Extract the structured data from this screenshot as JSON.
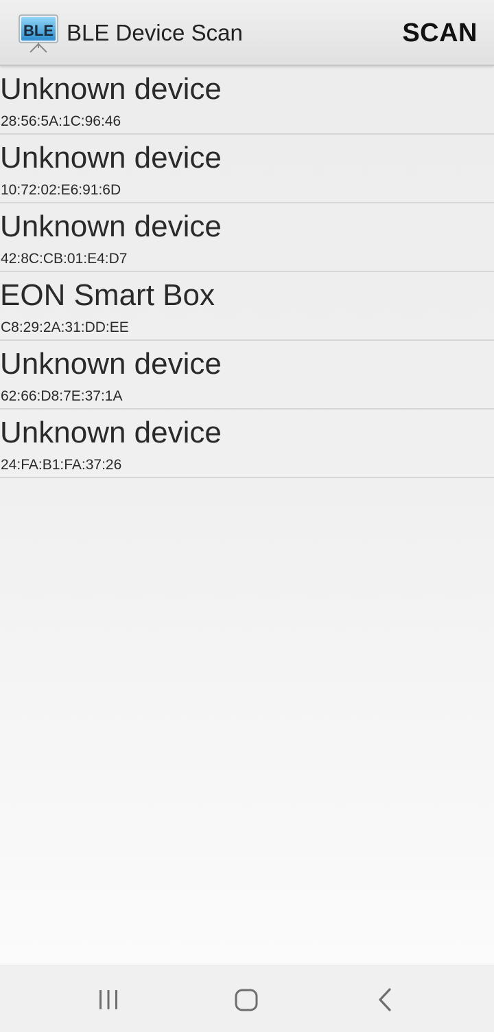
{
  "action_bar": {
    "title": "BLE Device Scan",
    "icon_text": "BLE",
    "scan_label": "SCAN"
  },
  "devices": [
    {
      "name": "Unknown device",
      "address": "28:56:5A:1C:96:46"
    },
    {
      "name": "Unknown device",
      "address": "10:72:02:E6:91:6D"
    },
    {
      "name": "Unknown device",
      "address": "42:8C:CB:01:E4:D7"
    },
    {
      "name": "EON Smart Box",
      "address": "C8:29:2A:31:DD:EE"
    },
    {
      "name": "Unknown device",
      "address": "62:66:D8:7E:37:1A"
    },
    {
      "name": "Unknown device",
      "address": "24:FA:B1:FA:37:26"
    }
  ],
  "nav_bar": {
    "icons": [
      "recent-apps-icon",
      "home-icon",
      "back-icon"
    ]
  },
  "colors": {
    "icon_screen": "#3d9fd8",
    "text_primary": "#2a2a2a",
    "divider": "#d6d6d6"
  }
}
